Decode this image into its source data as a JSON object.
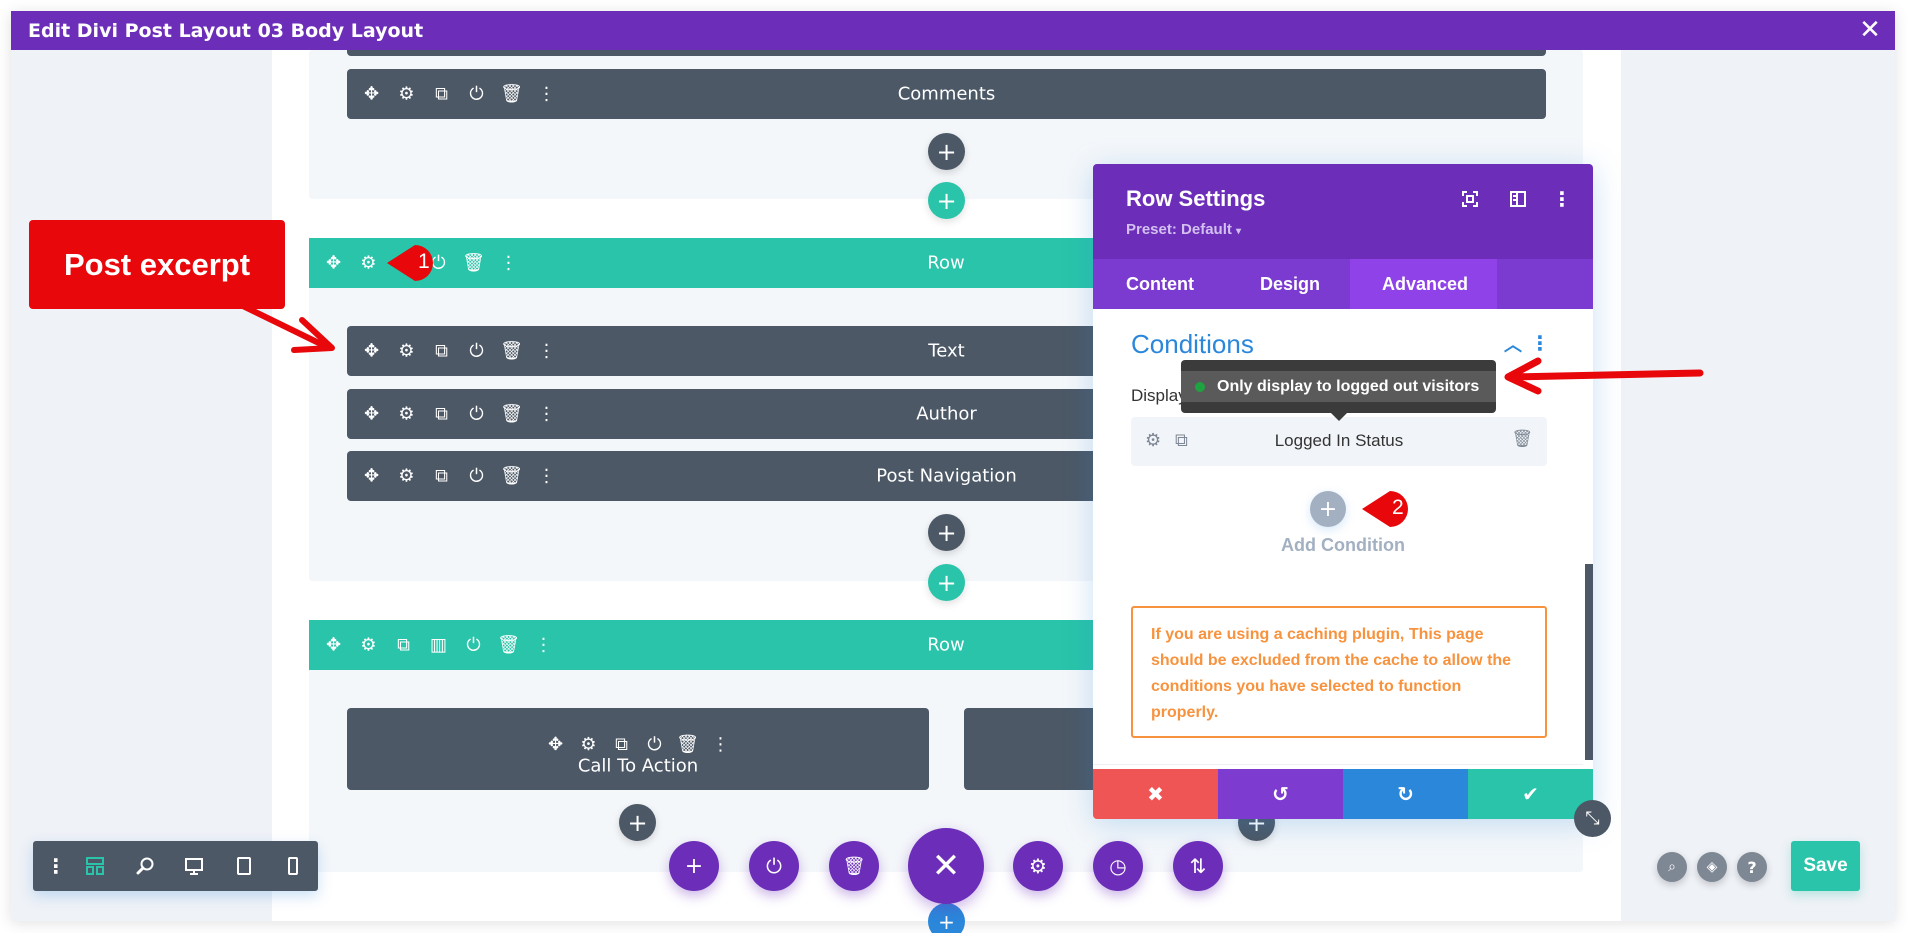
{
  "window": {
    "title": "Edit Divi Post Layout 03 Body Layout",
    "close_icon": "close-icon"
  },
  "builder": {
    "section1": {
      "modules": [
        {
          "label": "Comments"
        }
      ]
    },
    "section2": {
      "row_label": "Row",
      "modules": [
        {
          "label": "Text"
        },
        {
          "label": "Author"
        },
        {
          "label": "Post Navigation"
        }
      ]
    },
    "section3": {
      "row_label": "Row",
      "modules": [
        {
          "label": "Call To Action"
        }
      ]
    }
  },
  "annotations": {
    "callout_label": "Post excerpt",
    "badge1": "1",
    "badge2": "2",
    "colors": {
      "annotation_red": "#e8070a"
    }
  },
  "settings_panel": {
    "title": "Row Settings",
    "preset": "Preset: Default",
    "tabs": [
      {
        "label": "Content",
        "active": false
      },
      {
        "label": "Design",
        "active": false
      },
      {
        "label": "Advanced",
        "active": true
      }
    ],
    "section_title": "Conditions",
    "display_conditions_label": "Display Conditions",
    "tooltip": "Only display to logged out visitors",
    "condition_item": "Logged In Status",
    "add_condition_label": "Add Condition",
    "notice": "If you are using a caching plugin, This page should be excluded from the cache to allow the conditions you have selected to function properly.",
    "footer": {
      "cancel": "cancel",
      "undo": "undo",
      "redo": "redo",
      "save": "save"
    },
    "colors": {
      "header": "#6c2eb9",
      "tabs": "#7b3bd0",
      "active_tab": "#8e42e8",
      "accent_blue": "#2b87da",
      "notice_orange": "#f7933e",
      "cancel": "#ef5555",
      "undo": "#7e3bd0",
      "redo": "#2b87da",
      "save": "#29c4a9"
    }
  },
  "bottom": {
    "save_label": "Save",
    "colors": {
      "row_green": "#29c4a9",
      "module_dark": "#4c5866",
      "purple": "#6c2eb9"
    }
  }
}
